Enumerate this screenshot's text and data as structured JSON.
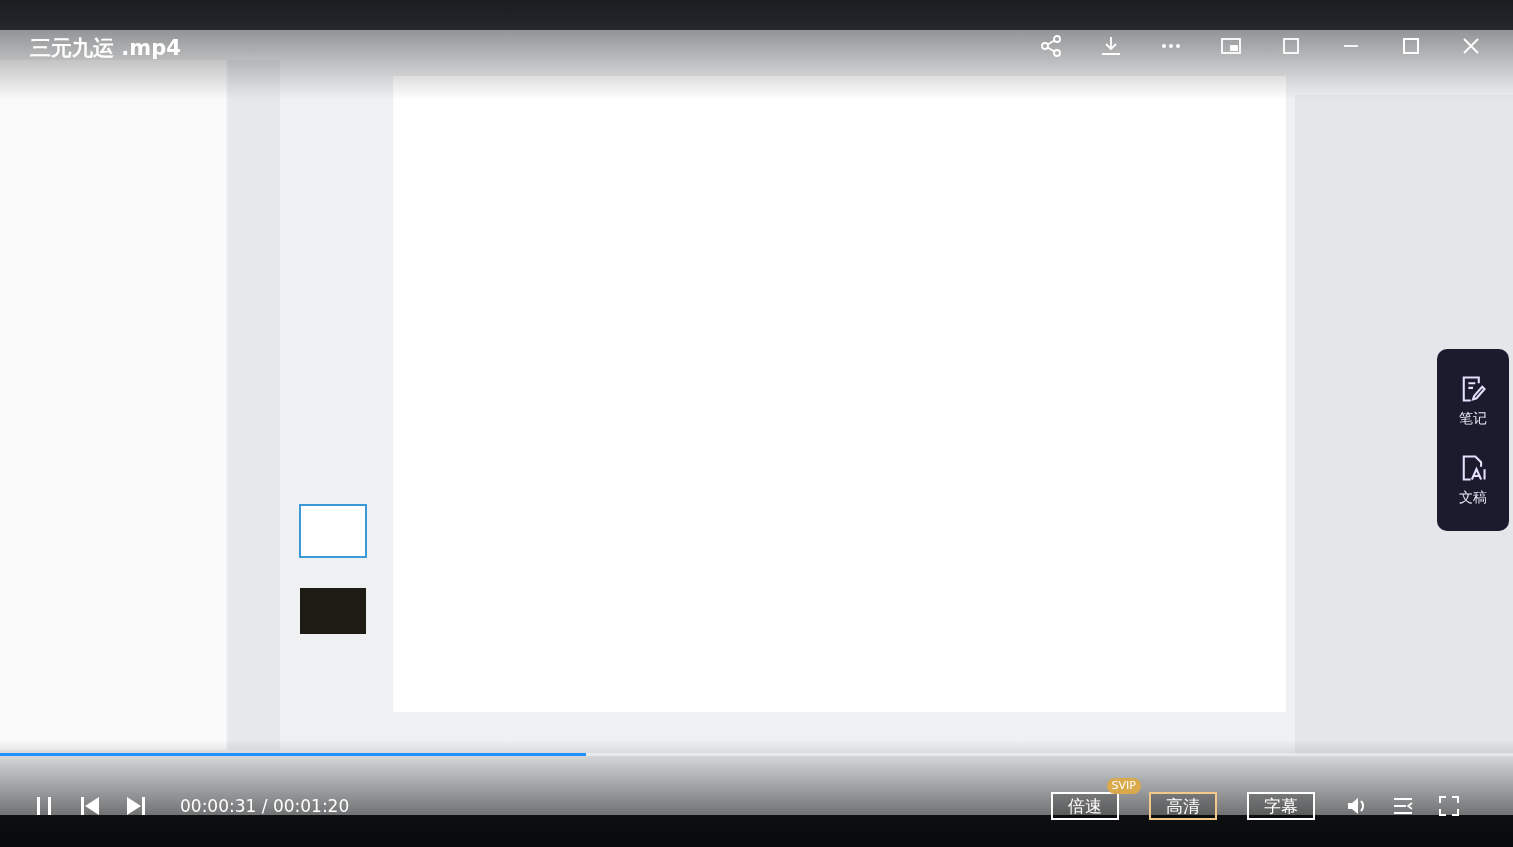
{
  "video": {
    "title": "三元九运 .mp4"
  },
  "side_panel": [
    {
      "kind": "note",
      "label": "笔记"
    },
    {
      "kind": "transcript",
      "label": "文稿"
    }
  ],
  "player": {
    "progress": {
      "level": 0.387
    },
    "playing": true,
    "time": "00:00:31 / 00:01:20",
    "buttons": [
      {
        "label": "倍速",
        "badge": "SVIP",
        "selected": false
      },
      {
        "label": "高清",
        "selected": true
      },
      {
        "label": "字幕",
        "selected": false
      }
    ]
  }
}
